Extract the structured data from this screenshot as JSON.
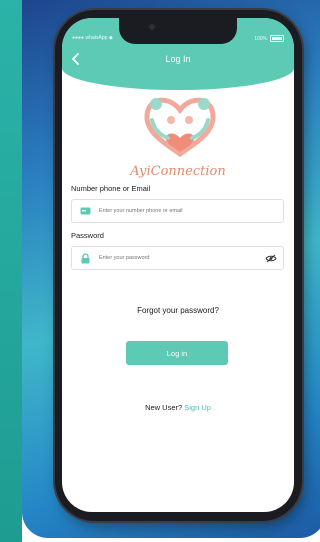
{
  "status_bar": {
    "carrier": "●●●● whatsApp ◆",
    "battery": "100%"
  },
  "header": {
    "title": "Log In"
  },
  "brand": {
    "name": "AyiConnection"
  },
  "form": {
    "email_label": "Number phone or Email",
    "email_placeholder": "Enter your number phone or email",
    "password_label": "Password",
    "password_placeholder": "Enter your password"
  },
  "links": {
    "forgot": "Forgot your password?"
  },
  "actions": {
    "login_label": "Log in"
  },
  "footer": {
    "new_user": "New User?",
    "sign_up": "Sign Up"
  },
  "colors": {
    "accent": "#5ccab5",
    "brand_text": "#e58a6c"
  },
  "icons": [
    "chevron-left-icon",
    "card-icon",
    "lock-icon",
    "eye-off-icon"
  ]
}
